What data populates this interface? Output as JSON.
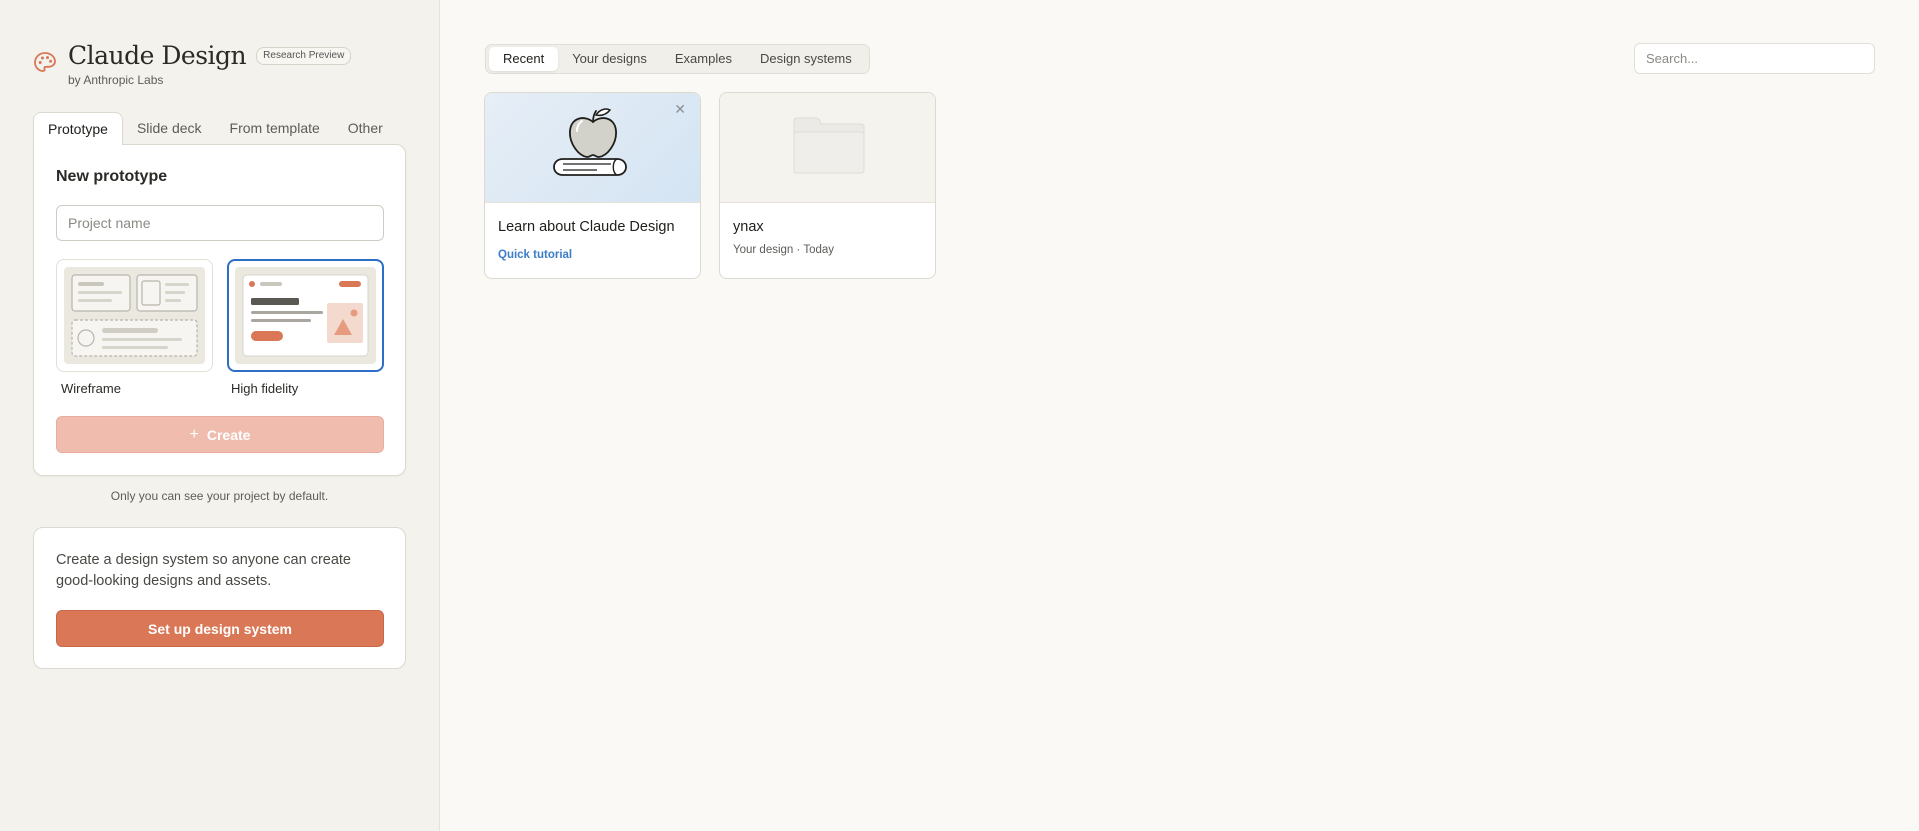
{
  "brand": {
    "title": "Claude Design",
    "badge": "Research Preview",
    "subtitle": "by Anthropic Labs",
    "icon": "palette-icon",
    "accent_color": "#d97757"
  },
  "sidebar": {
    "tabs": [
      {
        "label": "Prototype",
        "active": true
      },
      {
        "label": "Slide deck",
        "active": false
      },
      {
        "label": "From template",
        "active": false
      },
      {
        "label": "Other",
        "active": false
      }
    ],
    "panel": {
      "title": "New prototype",
      "project_name": {
        "value": "",
        "placeholder": "Project name"
      },
      "options": [
        {
          "label": "Wireframe",
          "selected": false
        },
        {
          "label": "High fidelity",
          "selected": true
        }
      ],
      "create_label": "Create",
      "create_icon": "plus-icon"
    },
    "privacy_note": "Only you can see your project by default.",
    "design_system": {
      "text": "Create a design system so anyone can create good-looking designs and assets.",
      "button_label": "Set up design system"
    }
  },
  "main": {
    "filter_tabs": [
      {
        "label": "Recent",
        "active": true
      },
      {
        "label": "Your designs",
        "active": false
      },
      {
        "label": "Examples",
        "active": false
      },
      {
        "label": "Design systems",
        "active": false
      }
    ],
    "search": {
      "value": "",
      "placeholder": "Search..."
    },
    "cards": [
      {
        "title": "Learn about Claude Design",
        "link": "Quick tutorial",
        "thumb_icon": "apple-on-book-icon",
        "close_icon": "close-icon"
      },
      {
        "title": "ynax",
        "meta": "Your design · Today",
        "thumb_icon": "folder-icon"
      }
    ],
    "selection_color": "#2d6ec6",
    "link_color": "#3a7dc9"
  }
}
